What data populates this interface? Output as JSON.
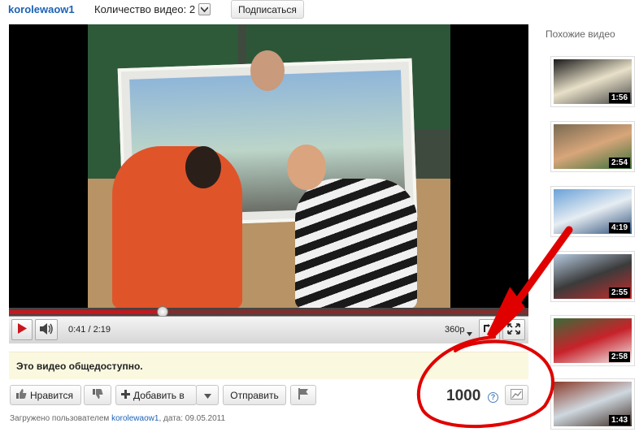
{
  "header": {
    "channel_name": "korolewaow1",
    "video_count_label": "Количество видео: 2",
    "subscribe_label": "Подписаться"
  },
  "player": {
    "time_label": "0:41 / 2:19",
    "quality_label": "360p",
    "progress_played_fraction": 0.295,
    "icons": [
      "play-icon",
      "volume-icon",
      "widescreen-icon",
      "fullscreen-icon"
    ]
  },
  "notice": {
    "text": "Это видео общедоступно."
  },
  "actions": {
    "like_label": "Нравится",
    "add_label": "Добавить в",
    "share_label": "Отправить",
    "view_count": "1000",
    "help_symbol": "?"
  },
  "uploaded": {
    "prefix": "Загружено пользователем",
    "user": "korolewaow1",
    "date_text": ", дата: 09.05.2011"
  },
  "sidebar": {
    "title": "Похожие видео",
    "items": [
      {
        "duration": "1:56",
        "colors": [
          "#1a1a1a",
          "#e8e0c8",
          "#444"
        ]
      },
      {
        "duration": "2:54",
        "colors": [
          "#7a6a52",
          "#d8a67a",
          "#3a6f3a"
        ]
      },
      {
        "duration": "4:19",
        "colors": [
          "#6aa2d8",
          "#e6edf2",
          "#2d4f7a"
        ]
      },
      {
        "duration": "2:55",
        "colors": [
          "#b7cbe0",
          "#3b3b3b",
          "#c62b2b"
        ]
      },
      {
        "duration": "2:58",
        "colors": [
          "#3a6b3a",
          "#c7222a",
          "#f2f2f2"
        ]
      },
      {
        "duration": "1:43",
        "colors": [
          "#8a3c2a",
          "#cfd8df",
          "#3d2a22"
        ]
      }
    ]
  },
  "colors": {
    "link_blue": "#1c62b9",
    "annotation_red": "#e00000",
    "notice_bg": "#fbf8e0"
  }
}
